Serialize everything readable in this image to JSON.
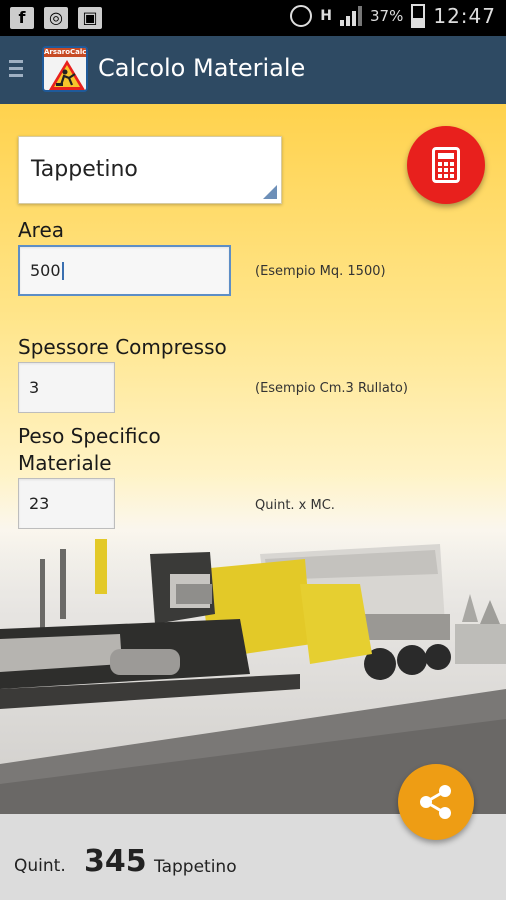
{
  "status_bar": {
    "battery_percent": "37%",
    "network_badge": "H",
    "time": "12:47",
    "icons": [
      "facebook-icon",
      "instagram-icon",
      "save-icon",
      "alarm-icon",
      "signal-icon",
      "battery-icon"
    ]
  },
  "app_bar": {
    "title": "Calcolo Materiale",
    "logo_label": "ArsaroCalc",
    "menu_icon": "menu-icon"
  },
  "form": {
    "material_select": {
      "value": "Tappetino"
    },
    "area": {
      "label": "Area",
      "value": "500",
      "hint": "(Esempio Mq. 1500)"
    },
    "thickness": {
      "label": "Spessore Compresso",
      "value": "3",
      "hint": "(Esempio Cm.3 Rullato)"
    },
    "density": {
      "label_line1": "Peso Specifico",
      "label_line2": "Materiale",
      "value": "23",
      "hint": "Quint. x MC."
    }
  },
  "result": {
    "unit": "Quint.",
    "value": "345",
    "material": "Tappetino"
  },
  "colors": {
    "app_bar": "#2e4a63",
    "calc_button": "#e8201d",
    "share_button": "#ee9d14",
    "yellow": "#ffd24d",
    "bottom_bar": "#dcdcdc"
  }
}
